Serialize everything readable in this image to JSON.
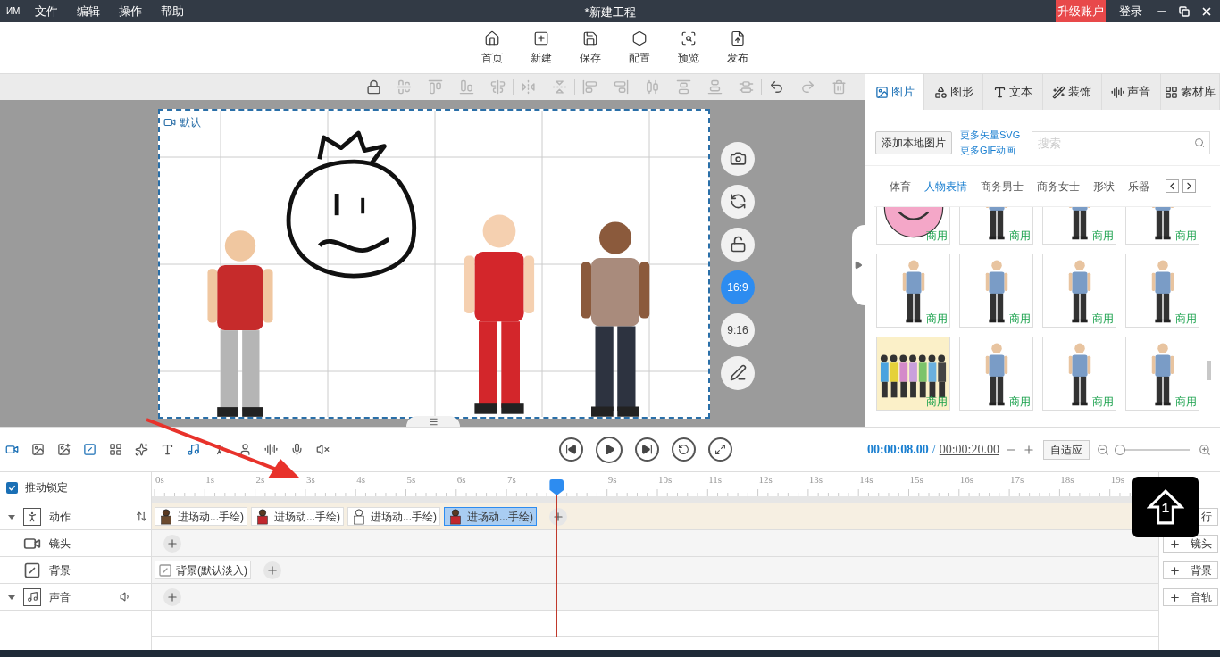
{
  "menu_bar": {
    "logo": "ИM",
    "items": [
      "文件",
      "编辑",
      "操作",
      "帮助"
    ],
    "title": "*新建工程",
    "upgrade": "升级账户",
    "login": "登录"
  },
  "toolbar": [
    "首页",
    "新建",
    "保存",
    "配置",
    "预览",
    "发布"
  ],
  "edit_toolbar": [
    [
      {
        "disabled": false
      }
    ],
    [
      {
        "disabled": true
      },
      {
        "disabled": true
      },
      {
        "disabled": true
      },
      {
        "disabled": true
      }
    ],
    [
      {
        "disabled": true
      },
      {
        "disabled": true
      }
    ],
    [
      {
        "disabled": true
      },
      {
        "disabled": true
      },
      {
        "disabled": true
      },
      {
        "disabled": true
      },
      {
        "disabled": true
      },
      {
        "disabled": true
      }
    ],
    [
      {
        "disabled": false
      },
      {
        "disabled": true
      },
      {
        "disabled": true
      }
    ]
  ],
  "canvas": {
    "camera_label": "默认"
  },
  "canvas_tools": [
    {
      "kind": "icon"
    },
    {
      "kind": "icon"
    },
    {
      "kind": "icon"
    },
    {
      "kind": "ratio",
      "label": "16:9",
      "selected": true
    },
    {
      "kind": "ratio",
      "label": "9:16",
      "selected": false
    },
    {
      "kind": "icon"
    }
  ],
  "panel": {
    "tabs": [
      {
        "label": "图片",
        "selected": true
      },
      {
        "label": "图形",
        "selected": false
      },
      {
        "label": "文本",
        "selected": false
      },
      {
        "label": "装饰",
        "selected": false
      },
      {
        "label": "声音",
        "selected": false
      },
      {
        "label": "素材库",
        "selected": false
      }
    ],
    "add_button": "添加本地图片",
    "links": [
      "更多矢量SVG",
      "更多GIF动画"
    ],
    "search_placeholder": "搜索",
    "categories": [
      {
        "label": "体育",
        "selected": false
      },
      {
        "label": "人物表情",
        "selected": true
      },
      {
        "label": "商务男士",
        "selected": false
      },
      {
        "label": "商务女士",
        "selected": false
      },
      {
        "label": "形状",
        "selected": false
      },
      {
        "label": "乐器",
        "selected": false
      }
    ],
    "items": [
      {
        "kind": "face",
        "badge": "商用"
      },
      {
        "kind": "person",
        "badge": "商用"
      },
      {
        "kind": "person",
        "badge": "商用"
      },
      {
        "kind": "person",
        "badge": "商用"
      },
      {
        "kind": "person",
        "badge": "商用"
      },
      {
        "kind": "person",
        "badge": "商用"
      },
      {
        "kind": "person",
        "badge": "商用"
      },
      {
        "kind": "person",
        "badge": "商用"
      },
      {
        "kind": "group",
        "badge": "商用"
      },
      {
        "kind": "person",
        "badge": "商用"
      },
      {
        "kind": "person",
        "badge": "商用"
      },
      {
        "kind": "person",
        "badge": "商用"
      }
    ]
  },
  "timeline_tools": [
    {
      "active": true
    },
    {
      "active": false
    },
    {
      "active": false
    },
    {
      "active": true
    },
    {
      "active": false
    },
    {
      "active": false
    },
    {
      "active": false
    },
    {
      "active": true
    },
    {
      "active": false
    },
    {
      "active": false
    },
    {
      "active": false
    },
    {
      "active": false
    },
    {
      "active": false
    }
  ],
  "playback": {
    "current": "00:00:08.00",
    "separator": "/",
    "total": "00:00:20.00",
    "fit_button": "自适应",
    "zoom": {
      "level": 0.03
    }
  },
  "lock": {
    "label": "推动锁定",
    "checked": true
  },
  "ruler": {
    "ticks": [
      "0s",
      "1s",
      "2s",
      "3s",
      "4s",
      "5s",
      "6s",
      "7s",
      "9s",
      "10s",
      "11s",
      "12s",
      "13s",
      "14s",
      "15s",
      "16s",
      "17s",
      "18s",
      "19s"
    ],
    "playhead": {
      "level": 0.4
    }
  },
  "tracks": [
    {
      "kind": "action",
      "label": "动作",
      "expanded": true,
      "add_button": "行",
      "clips": [
        {
          "label": "进场动...手绘)",
          "selected": false
        },
        {
          "label": "进场动...手绘)",
          "selected": false
        },
        {
          "label": "进场动...手绘)",
          "selected": false
        },
        {
          "label": "进场动...手绘)",
          "selected": true
        }
      ]
    },
    {
      "kind": "camera",
      "label": "镜头",
      "add_button": "镜头"
    },
    {
      "kind": "background",
      "label": "背景",
      "add_button": "背景",
      "clips": [
        {
          "label": "背景(默认淡入)",
          "selected": false
        }
      ]
    },
    {
      "kind": "sound",
      "label": "声音",
      "expanded": true,
      "add_button": "音轨"
    }
  ],
  "key_overlay": {
    "label": "1"
  }
}
